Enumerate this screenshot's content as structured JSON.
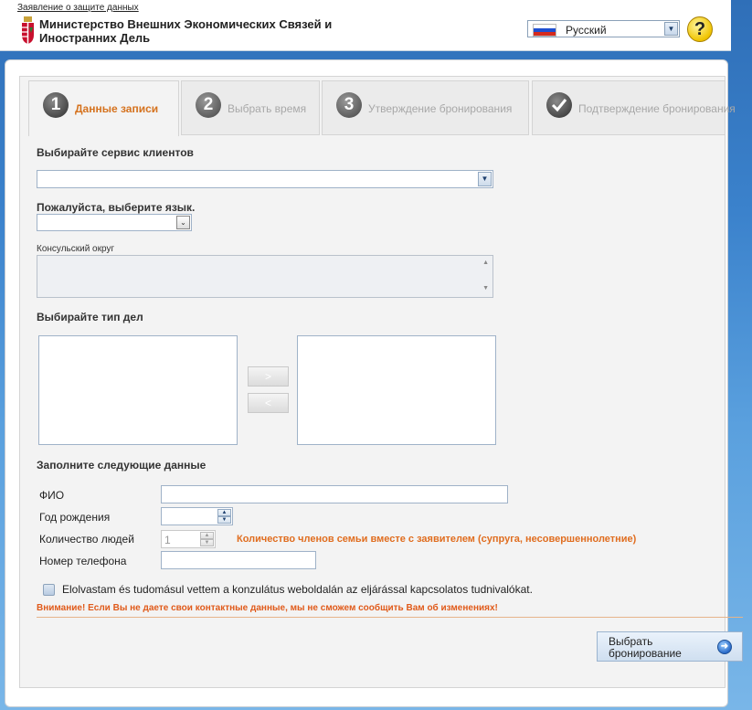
{
  "header": {
    "privacy_link": "Заявление о защите данных",
    "ministry_name_line1": "Министерство Внешних Экономических Связей и",
    "ministry_name_line2": "Иностранних Дель",
    "language": {
      "selected": "Русский",
      "flag": "russia-flag"
    },
    "help_icon_text": "?"
  },
  "tabs": [
    {
      "number": "1",
      "label": "Данные записи",
      "active": true
    },
    {
      "number": "2",
      "label": "Выбрать время",
      "active": false
    },
    {
      "number": "3",
      "label": "Утверждение бронирования",
      "active": false
    },
    {
      "number": "",
      "icon": "checkmark-icon",
      "label": "Подтверждение бронирования",
      "active": false
    }
  ],
  "form": {
    "service_label": "Выбирайте сервис клиентов",
    "service_value": "",
    "language_label": "Пожалуйста, выберите язык.",
    "language_value": "",
    "consular_label": "Консульский округ",
    "case_type_label": "Выбирайте тип дел",
    "move_right": ">",
    "move_left": "<",
    "fill_data_label": "Заполните следующие данные",
    "name_label": "ФИО",
    "name_value": "",
    "birth_year_label": "Год рождения",
    "birth_year_value": "",
    "people_count_label": "Количество людей",
    "people_count_value": "1",
    "people_count_note": "Количество членов семьи вместе с заявителем (супруга, несовершеннолетние)",
    "phone_label": "Номер телефона",
    "phone_value": "",
    "agree_text": "Elolvastam és tudomásul vettem a konzulátus weboldalán az eljárással kapcsolatos tudnivalókat.",
    "warning": "Внимание! Если Вы не даете свои контактные данные, мы не сможем сообщить Вам об изменениях!",
    "submit_line1": "Выбрать",
    "submit_line2": "бронирование"
  },
  "colors": {
    "accent_orange": "#e06d1f",
    "background_blue": "#3b82cc"
  }
}
